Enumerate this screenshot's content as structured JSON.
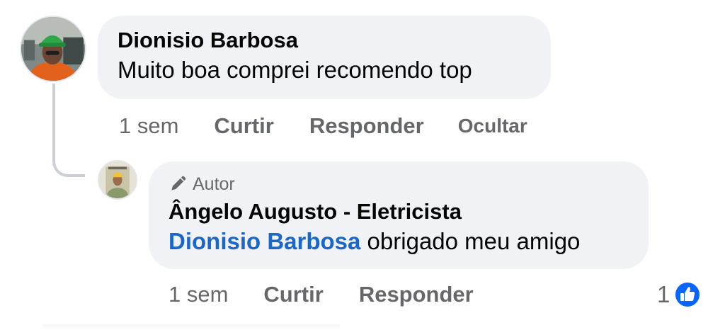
{
  "comment": {
    "author": "Dionisio Barbosa",
    "text": "Muito boa comprei recomendo top",
    "actions": {
      "time": "1 sem",
      "like": "Curtir",
      "reply": "Responder",
      "hide": "Ocultar"
    }
  },
  "reply": {
    "badge": "Autor",
    "author": "Ângelo Augusto - Eletricista",
    "mention": "Dionisio Barbosa",
    "text": " obrigado meu amigo",
    "actions": {
      "time": "1 sem",
      "like": "Curtir",
      "reply": "Responder"
    },
    "reaction_count": "1"
  },
  "colors": {
    "bubble": "#f0f2f5",
    "secondary_text": "#65676b",
    "mention": "#1b66c9",
    "like_blue": "#0866ff"
  },
  "icons": {
    "author_badge": "pencil-icon",
    "reaction": "like-icon"
  }
}
